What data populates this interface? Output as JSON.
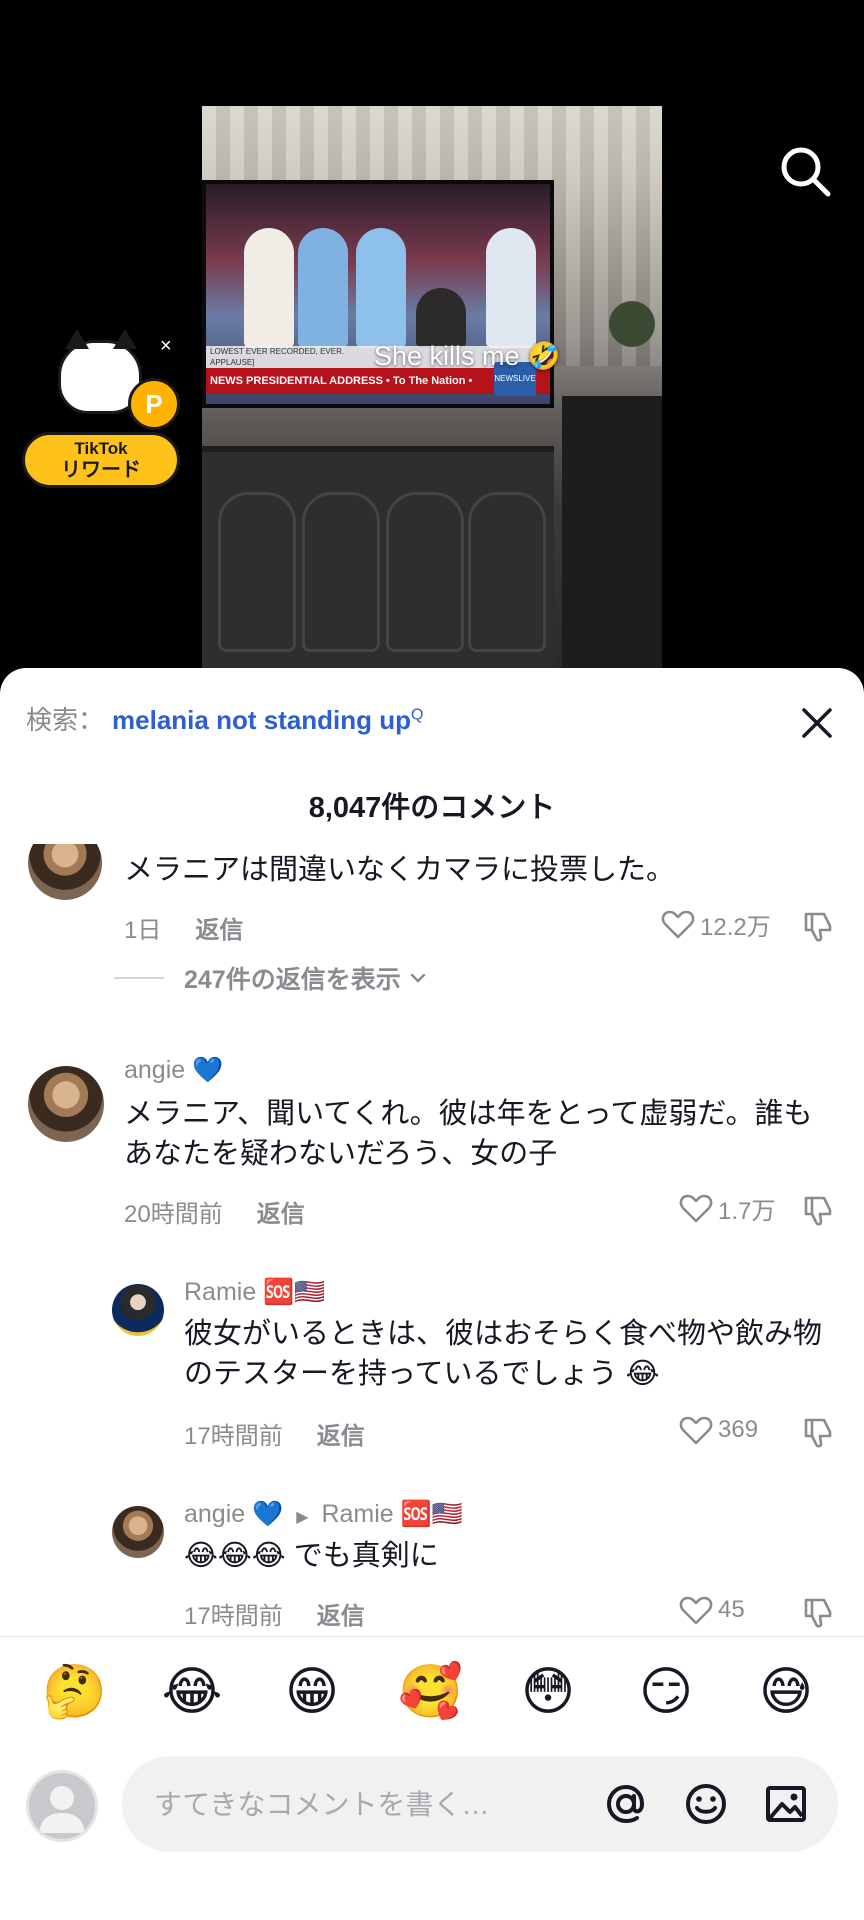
{
  "video": {
    "caption": "She kills me 🤣",
    "tv_ticker": "NEWS PRESIDENTIAL ADDRESS • To The Nation •",
    "tv_lower_line1": "LOWEST EVER RECORDED, EVER.",
    "tv_lower_line2": "APPLAUSE]",
    "tv_logo": "NEWSLIVE"
  },
  "rewards": {
    "line1": "TikTok",
    "line2": "リワード",
    "close": "×",
    "coin": "P"
  },
  "sheet": {
    "search_prefix": "検索：",
    "search_query": "melania not standing up",
    "search_sup": "Q",
    "comment_count": "8,047件のコメント"
  },
  "comments": [
    {
      "text": "メラニアは間違いなくカマラに投票した。",
      "time": "1日",
      "reply_label": "返信",
      "likes": "12.2万",
      "view_replies": "247件の返信を表示"
    },
    {
      "name": "angie 💙",
      "text": "メラニア、聞いてくれ。彼は年をとって虚弱だ。誰もあなたを疑わないだろう、女の子",
      "time": "20時間前",
      "reply_label": "返信",
      "likes": "1.7万"
    },
    {
      "name": "Ramie 🆘🇺🇸",
      "text": "彼女がいるときは、彼はおそらく食べ物や飲み物のテスターを持っているでしょう 😂",
      "time": "17時間前",
      "reply_label": "返信",
      "likes": "369"
    },
    {
      "name": "angie 💙",
      "reply_to": "Ramie 🆘🇺🇸",
      "text": "😂😂😂 でも真剣に",
      "time": "17時間前",
      "reply_label": "返信",
      "likes": "45"
    }
  ],
  "emoji_bar": [
    "🤔",
    "😂",
    "😁",
    "🥰",
    "😳",
    "😏",
    "😅"
  ],
  "composer": {
    "placeholder": "すてきなコメントを書く…"
  },
  "colors": {
    "link_blue": "#2b5fd3",
    "muted_gray": "#8a8b91",
    "reward_yellow": "#ffc21a"
  }
}
